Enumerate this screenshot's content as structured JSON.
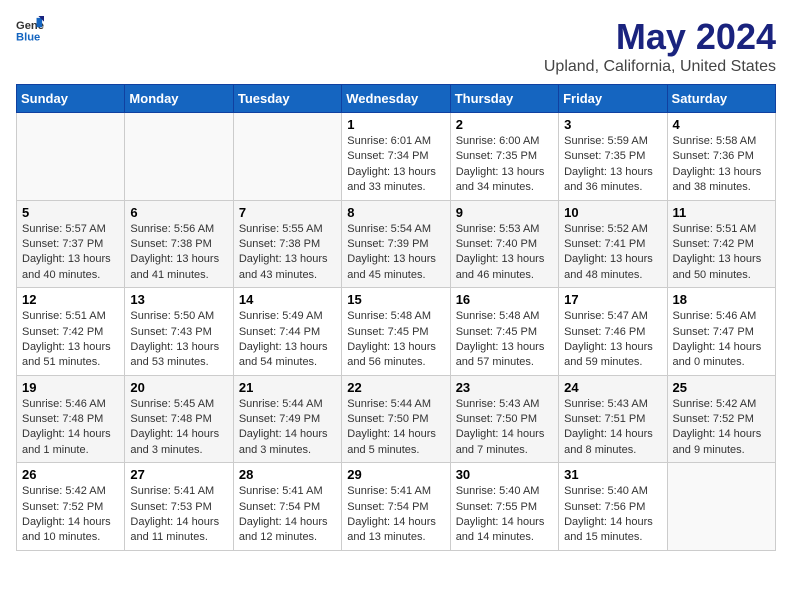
{
  "header": {
    "logo_general": "General",
    "logo_blue": "Blue",
    "title": "May 2024",
    "subtitle": "Upland, California, United States"
  },
  "days_of_week": [
    "Sunday",
    "Monday",
    "Tuesday",
    "Wednesday",
    "Thursday",
    "Friday",
    "Saturday"
  ],
  "weeks": [
    [
      {
        "day": "",
        "info": ""
      },
      {
        "day": "",
        "info": ""
      },
      {
        "day": "",
        "info": ""
      },
      {
        "day": "1",
        "info": "Sunrise: 6:01 AM\nSunset: 7:34 PM\nDaylight: 13 hours\nand 33 minutes."
      },
      {
        "day": "2",
        "info": "Sunrise: 6:00 AM\nSunset: 7:35 PM\nDaylight: 13 hours\nand 34 minutes."
      },
      {
        "day": "3",
        "info": "Sunrise: 5:59 AM\nSunset: 7:35 PM\nDaylight: 13 hours\nand 36 minutes."
      },
      {
        "day": "4",
        "info": "Sunrise: 5:58 AM\nSunset: 7:36 PM\nDaylight: 13 hours\nand 38 minutes."
      }
    ],
    [
      {
        "day": "5",
        "info": "Sunrise: 5:57 AM\nSunset: 7:37 PM\nDaylight: 13 hours\nand 40 minutes."
      },
      {
        "day": "6",
        "info": "Sunrise: 5:56 AM\nSunset: 7:38 PM\nDaylight: 13 hours\nand 41 minutes."
      },
      {
        "day": "7",
        "info": "Sunrise: 5:55 AM\nSunset: 7:38 PM\nDaylight: 13 hours\nand 43 minutes."
      },
      {
        "day": "8",
        "info": "Sunrise: 5:54 AM\nSunset: 7:39 PM\nDaylight: 13 hours\nand 45 minutes."
      },
      {
        "day": "9",
        "info": "Sunrise: 5:53 AM\nSunset: 7:40 PM\nDaylight: 13 hours\nand 46 minutes."
      },
      {
        "day": "10",
        "info": "Sunrise: 5:52 AM\nSunset: 7:41 PM\nDaylight: 13 hours\nand 48 minutes."
      },
      {
        "day": "11",
        "info": "Sunrise: 5:51 AM\nSunset: 7:42 PM\nDaylight: 13 hours\nand 50 minutes."
      }
    ],
    [
      {
        "day": "12",
        "info": "Sunrise: 5:51 AM\nSunset: 7:42 PM\nDaylight: 13 hours\nand 51 minutes."
      },
      {
        "day": "13",
        "info": "Sunrise: 5:50 AM\nSunset: 7:43 PM\nDaylight: 13 hours\nand 53 minutes."
      },
      {
        "day": "14",
        "info": "Sunrise: 5:49 AM\nSunset: 7:44 PM\nDaylight: 13 hours\nand 54 minutes."
      },
      {
        "day": "15",
        "info": "Sunrise: 5:48 AM\nSunset: 7:45 PM\nDaylight: 13 hours\nand 56 minutes."
      },
      {
        "day": "16",
        "info": "Sunrise: 5:48 AM\nSunset: 7:45 PM\nDaylight: 13 hours\nand 57 minutes."
      },
      {
        "day": "17",
        "info": "Sunrise: 5:47 AM\nSunset: 7:46 PM\nDaylight: 13 hours\nand 59 minutes."
      },
      {
        "day": "18",
        "info": "Sunrise: 5:46 AM\nSunset: 7:47 PM\nDaylight: 14 hours\nand 0 minutes."
      }
    ],
    [
      {
        "day": "19",
        "info": "Sunrise: 5:46 AM\nSunset: 7:48 PM\nDaylight: 14 hours\nand 1 minute."
      },
      {
        "day": "20",
        "info": "Sunrise: 5:45 AM\nSunset: 7:48 PM\nDaylight: 14 hours\nand 3 minutes."
      },
      {
        "day": "21",
        "info": "Sunrise: 5:44 AM\nSunset: 7:49 PM\nDaylight: 14 hours\nand 3 minutes."
      },
      {
        "day": "22",
        "info": "Sunrise: 5:44 AM\nSunset: 7:50 PM\nDaylight: 14 hours\nand 5 minutes."
      },
      {
        "day": "23",
        "info": "Sunrise: 5:43 AM\nSunset: 7:50 PM\nDaylight: 14 hours\nand 7 minutes."
      },
      {
        "day": "24",
        "info": "Sunrise: 5:43 AM\nSunset: 7:51 PM\nDaylight: 14 hours\nand 8 minutes."
      },
      {
        "day": "25",
        "info": "Sunrise: 5:42 AM\nSunset: 7:52 PM\nDaylight: 14 hours\nand 9 minutes."
      }
    ],
    [
      {
        "day": "26",
        "info": "Sunrise: 5:42 AM\nSunset: 7:52 PM\nDaylight: 14 hours\nand 10 minutes."
      },
      {
        "day": "27",
        "info": "Sunrise: 5:41 AM\nSunset: 7:53 PM\nDaylight: 14 hours\nand 11 minutes."
      },
      {
        "day": "28",
        "info": "Sunrise: 5:41 AM\nSunset: 7:54 PM\nDaylight: 14 hours\nand 12 minutes."
      },
      {
        "day": "29",
        "info": "Sunrise: 5:41 AM\nSunset: 7:54 PM\nDaylight: 14 hours\nand 13 minutes."
      },
      {
        "day": "30",
        "info": "Sunrise: 5:40 AM\nSunset: 7:55 PM\nDaylight: 14 hours\nand 14 minutes."
      },
      {
        "day": "31",
        "info": "Sunrise: 5:40 AM\nSunset: 7:56 PM\nDaylight: 14 hours\nand 15 minutes."
      },
      {
        "day": "",
        "info": ""
      }
    ]
  ]
}
